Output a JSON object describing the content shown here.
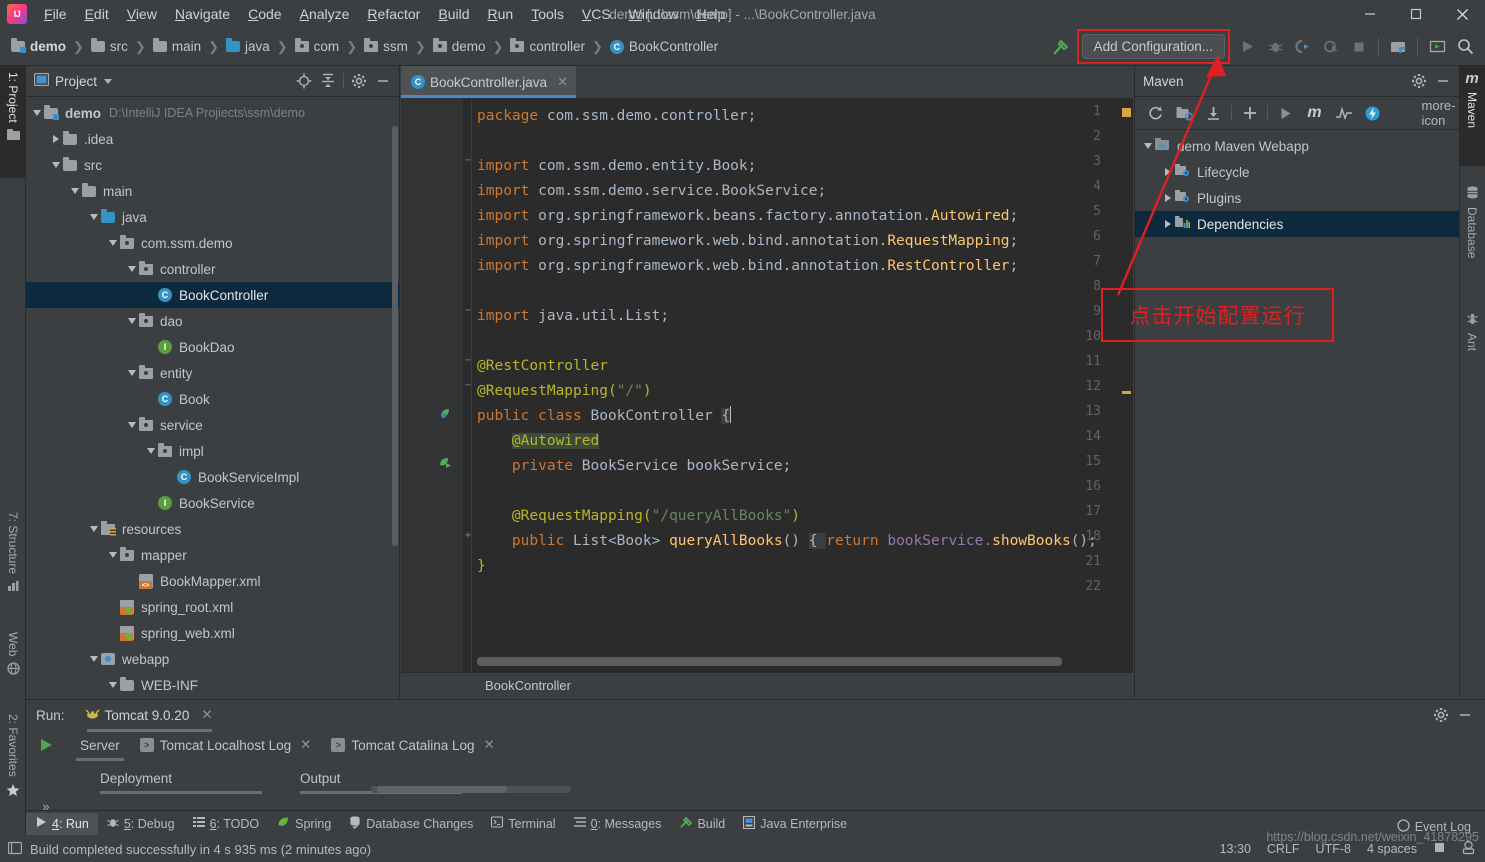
{
  "window": {
    "title": "demo [...\\ssm\\demo] - ...\\BookController.java",
    "minimize": "—",
    "maximize": "▢",
    "close": "✕"
  },
  "menu": [
    {
      "label": "File"
    },
    {
      "label": "Edit"
    },
    {
      "label": "View"
    },
    {
      "label": "Navigate"
    },
    {
      "label": "Code"
    },
    {
      "label": "Analyze"
    },
    {
      "label": "Refactor"
    },
    {
      "label": "Build"
    },
    {
      "label": "Run"
    },
    {
      "label": "Tools"
    },
    {
      "label": "VCS"
    },
    {
      "label": "Window"
    },
    {
      "label": "Help"
    }
  ],
  "breadcrumbs": [
    {
      "label": "demo",
      "icon": "module-folder-icon"
    },
    {
      "label": "src",
      "icon": "folder-icon"
    },
    {
      "label": "main",
      "icon": "folder-icon"
    },
    {
      "label": "java",
      "icon": "source-folder-icon"
    },
    {
      "label": "com",
      "icon": "package-icon"
    },
    {
      "label": "ssm",
      "icon": "package-icon"
    },
    {
      "label": "demo",
      "icon": "package-icon"
    },
    {
      "label": "controller",
      "icon": "package-icon"
    },
    {
      "label": "BookController",
      "icon": "class-icon"
    }
  ],
  "toolbar": {
    "add_configuration": "Add Configuration...",
    "build_icon": "hammer-icon",
    "run_icon": "run-icon",
    "debug_icon": "debug-icon",
    "run_coverage_icon": "run-with-coverage-icon",
    "profile_icon": "profiler-icon",
    "stop_icon": "stop-icon",
    "updates_icon": "project-structure-icon",
    "terminal_icon": "open-terminal-icon",
    "search_icon": "search-everywhere-icon"
  },
  "left_stripe": [
    {
      "label": "1: Project",
      "selected": true,
      "icon": "project-icon"
    },
    {
      "label": "7: Structure",
      "selected": false,
      "icon": "structure-icon"
    },
    {
      "label": "Web",
      "selected": false,
      "icon": "web-icon"
    },
    {
      "label": "2: Favorites",
      "selected": false,
      "icon": "star-icon"
    }
  ],
  "right_stripe": [
    {
      "label": "Maven",
      "selected": true,
      "icon": "maven-icon"
    },
    {
      "label": "Database",
      "selected": false,
      "icon": "database-icon"
    },
    {
      "label": "Ant",
      "selected": false,
      "icon": "ant-icon"
    }
  ],
  "project_panel": {
    "title": "Project",
    "icons": [
      "locate-icon",
      "collapse-all-icon",
      "gear-icon",
      "minimize-icon"
    ],
    "tree": [
      {
        "label": "demo",
        "path": "D:\\IntelliJ IDEA Projiects\\ssm\\demo",
        "indent": 0,
        "arrow": "down",
        "icon": "module-folder-icon",
        "bold": true
      },
      {
        "label": ".idea",
        "indent": 1,
        "arrow": "right",
        "icon": "folder-icon"
      },
      {
        "label": "src",
        "indent": 1,
        "arrow": "down",
        "icon": "folder-icon"
      },
      {
        "label": "main",
        "indent": 2,
        "arrow": "down",
        "icon": "folder-icon"
      },
      {
        "label": "java",
        "indent": 3,
        "arrow": "down",
        "icon": "source-folder-icon"
      },
      {
        "label": "com.ssm.demo",
        "indent": 4,
        "arrow": "down",
        "icon": "package-icon"
      },
      {
        "label": "controller",
        "indent": 5,
        "arrow": "down",
        "icon": "package-icon"
      },
      {
        "label": "BookController",
        "indent": 6,
        "arrow": "none",
        "icon": "class-icon",
        "selected": true
      },
      {
        "label": "dao",
        "indent": 5,
        "arrow": "down",
        "icon": "package-icon"
      },
      {
        "label": "BookDao",
        "indent": 6,
        "arrow": "none",
        "icon": "interface-icon"
      },
      {
        "label": "entity",
        "indent": 5,
        "arrow": "down",
        "icon": "package-icon"
      },
      {
        "label": "Book",
        "indent": 6,
        "arrow": "none",
        "icon": "class-icon"
      },
      {
        "label": "service",
        "indent": 5,
        "arrow": "down",
        "icon": "package-icon"
      },
      {
        "label": "impl",
        "indent": 6,
        "arrow": "down",
        "icon": "package-icon"
      },
      {
        "label": "BookServiceImpl",
        "indent": 7,
        "arrow": "none",
        "icon": "class-icon"
      },
      {
        "label": "BookService",
        "indent": 6,
        "arrow": "none",
        "icon": "interface-icon"
      },
      {
        "label": "resources",
        "indent": 3,
        "arrow": "down",
        "icon": "resource-folder-icon"
      },
      {
        "label": "mapper",
        "indent": 4,
        "arrow": "down",
        "icon": "package-icon"
      },
      {
        "label": "BookMapper.xml",
        "indent": 5,
        "arrow": "none",
        "icon": "xml-file-icon"
      },
      {
        "label": "spring_root.xml",
        "indent": 4,
        "arrow": "none",
        "icon": "spring-xml-icon"
      },
      {
        "label": "spring_web.xml",
        "indent": 4,
        "arrow": "none",
        "icon": "spring-xml-icon"
      },
      {
        "label": "webapp",
        "indent": 3,
        "arrow": "down",
        "icon": "webapp-icon"
      },
      {
        "label": "WEB-INF",
        "indent": 4,
        "arrow": "down",
        "icon": "folder-icon"
      }
    ]
  },
  "editor": {
    "tab": {
      "label": "BookController.java",
      "icon": "class-icon",
      "close": "✕"
    },
    "breadcrumb": "BookController",
    "lines": [
      {
        "no": "1",
        "tokens": [
          {
            "t": "package",
            "c": "k"
          },
          {
            "t": " com.ssm.demo.controller;",
            "c": "t"
          }
        ]
      },
      {
        "no": "2",
        "tokens": []
      },
      {
        "no": "3",
        "fold": "−",
        "tokens": [
          {
            "t": "import",
            "c": "k"
          },
          {
            "t": " com.ssm.demo.entity.Book;",
            "c": "t"
          }
        ]
      },
      {
        "no": "4",
        "tokens": [
          {
            "t": "import",
            "c": "k"
          },
          {
            "t": " com.ssm.demo.service.BookService;",
            "c": "t"
          }
        ]
      },
      {
        "no": "5",
        "tokens": [
          {
            "t": "import",
            "c": "k"
          },
          {
            "t": " org.springframework.beans.factory.annotation.",
            "c": "t"
          },
          {
            "t": "Autowired",
            "c": "n"
          },
          {
            "t": ";",
            "c": "t"
          }
        ]
      },
      {
        "no": "6",
        "tokens": [
          {
            "t": "import",
            "c": "k"
          },
          {
            "t": " org.springframework.web.bind.annotation.",
            "c": "t"
          },
          {
            "t": "RequestMapping",
            "c": "n"
          },
          {
            "t": ";",
            "c": "t"
          }
        ]
      },
      {
        "no": "7",
        "tokens": [
          {
            "t": "import",
            "c": "k"
          },
          {
            "t": " org.springframework.web.bind.annotation.",
            "c": "t"
          },
          {
            "t": "RestController",
            "c": "n"
          },
          {
            "t": ";",
            "c": "t"
          }
        ]
      },
      {
        "no": "8",
        "tokens": []
      },
      {
        "no": "9",
        "fold": "−",
        "tokens": [
          {
            "t": "import",
            "c": "k"
          },
          {
            "t": " java.util.List;",
            "c": "t"
          }
        ]
      },
      {
        "no": "10",
        "tokens": []
      },
      {
        "no": "11",
        "fold": "−",
        "tokens": [
          {
            "t": "@RestController",
            "c": "a"
          }
        ]
      },
      {
        "no": "12",
        "fold": "−",
        "tokens": [
          {
            "t": "@RequestMapping(",
            "c": "a"
          },
          {
            "t": "\"/\"",
            "c": "s"
          },
          {
            "t": ")",
            "c": "a"
          }
        ]
      },
      {
        "no": "13",
        "gutter_icon": "bean-class-icon",
        "tokens": [
          {
            "t": "public ",
            "c": "k"
          },
          {
            "t": "class ",
            "c": "k"
          },
          {
            "t": "BookController ",
            "c": "t"
          },
          {
            "t": "{",
            "c": "hl-brace"
          }
        ]
      },
      {
        "no": "14",
        "tokens": [
          {
            "t": "    ",
            "c": "t"
          },
          {
            "t": "@Autowired",
            "c": "a hl-auto"
          }
        ]
      },
      {
        "no": "15",
        "gutter_icon": "bean-autowired-icon",
        "tokens": [
          {
            "t": "    ",
            "c": "t"
          },
          {
            "t": "private ",
            "c": "k"
          },
          {
            "t": "BookService bookService;",
            "c": "t"
          }
        ]
      },
      {
        "no": "16",
        "tokens": []
      },
      {
        "no": "17",
        "tokens": [
          {
            "t": "    ",
            "c": "t"
          },
          {
            "t": "@RequestMapping(",
            "c": "a"
          },
          {
            "t": "\"/queryAllBooks\"",
            "c": "s"
          },
          {
            "t": ")",
            "c": "a"
          }
        ]
      },
      {
        "no": "18",
        "fold": "+",
        "tokens": [
          {
            "t": "    ",
            "c": "t"
          },
          {
            "t": "public ",
            "c": "k"
          },
          {
            "t": "List<Book> ",
            "c": "t"
          },
          {
            "t": "queryAllBooks",
            "c": "n"
          },
          {
            "t": "() ",
            "c": "t"
          },
          {
            "t": "{ ",
            "c": "hl-brace"
          },
          {
            "t": "return ",
            "c": "k"
          },
          {
            "t": "bookService.",
            "c": "f"
          },
          {
            "t": "showBooks",
            "c": "n"
          },
          {
            "t": "();",
            "c": "t"
          }
        ]
      },
      {
        "no": "21",
        "tokens": [
          {
            "t": "}",
            "c": "a"
          }
        ]
      },
      {
        "no": "22",
        "tokens": []
      }
    ]
  },
  "maven": {
    "title": "Maven",
    "header_icons": [
      "gear-icon",
      "minimize-icon"
    ],
    "toolbar_icons": [
      "reload-icon",
      "generate-sources-icon",
      "download-sources-icon",
      "add-icon",
      "run-icon",
      "execute-maven-goal-icon",
      "toggle-skip-tests-icon",
      "toggle-offline-icon",
      "more-icon"
    ],
    "tree": [
      {
        "label": "demo Maven Webapp",
        "indent": 0,
        "arrow": "down",
        "icon": "maven-project-icon"
      },
      {
        "label": "Lifecycle",
        "indent": 1,
        "arrow": "right",
        "icon": "lifecycle-folder-icon"
      },
      {
        "label": "Plugins",
        "indent": 1,
        "arrow": "right",
        "icon": "plugins-folder-icon"
      },
      {
        "label": "Dependencies",
        "indent": 1,
        "arrow": "right",
        "icon": "dependencies-folder-icon",
        "selected": true
      }
    ]
  },
  "run_window": {
    "label": "Run:",
    "config": {
      "label": "Tomcat 9.0.20",
      "icon": "tomcat-icon",
      "close": "✕"
    },
    "header_icons": [
      "gear-icon",
      "minimize-icon"
    ],
    "side_icons": [
      "rerun-icon",
      "expand-icon"
    ],
    "expand_more": "»",
    "tabs": [
      {
        "label": "Server",
        "selected": true,
        "icon": null,
        "close": null
      },
      {
        "label": "Tomcat Localhost Log",
        "selected": false,
        "icon": "log-icon",
        "close": "✕"
      },
      {
        "label": "Tomcat Catalina Log",
        "selected": false,
        "icon": "log-icon",
        "close": "✕"
      }
    ],
    "subtabs": [
      {
        "label": "Deployment",
        "selected": true
      },
      {
        "label": "Output",
        "selected": false
      }
    ]
  },
  "bottom_stripe": [
    {
      "label": "4: Run",
      "selected": true,
      "icon": "run-icon",
      "mnemonic": "4"
    },
    {
      "label": "5: Debug",
      "selected": false,
      "icon": "debug-icon",
      "mnemonic": "5"
    },
    {
      "label": "6: TODO",
      "selected": false,
      "icon": "todo-icon",
      "mnemonic": "6"
    },
    {
      "label": "Spring",
      "selected": false,
      "icon": "spring-icon"
    },
    {
      "label": "Database Changes",
      "selected": false,
      "icon": "database-changes-icon"
    },
    {
      "label": "Terminal",
      "selected": false,
      "icon": "terminal-icon"
    },
    {
      "label": "0: Messages",
      "selected": false,
      "icon": "messages-icon",
      "mnemonic": "0"
    },
    {
      "label": "Build",
      "selected": false,
      "icon": "build-icon"
    },
    {
      "label": "Java Enterprise",
      "selected": false,
      "icon": "java-enterprise-icon"
    }
  ],
  "status_bar": {
    "message": "Build completed successfully in 4 s 935 ms (2 minutes ago)",
    "event_log": "Event Log",
    "position": "13:30",
    "line_separator": "CRLF",
    "encoding": "UTF-8",
    "indent": "4 spaces"
  },
  "annotation": {
    "text": "点击开始配置运行",
    "color": "#e02020"
  },
  "watermark": "https://blog.csdn.net/weixin_41878295",
  "colors": {
    "accent": "#3592c4",
    "selection": "#0d293e",
    "panel_bg": "#3c3f41",
    "editor_bg": "#2b2b2b",
    "annotation_red": "#e02020",
    "keyword": "#cc7832",
    "string": "#6a8759",
    "annotation_code": "#bbb529",
    "method": "#ffc66d",
    "field": "#9876aa"
  }
}
